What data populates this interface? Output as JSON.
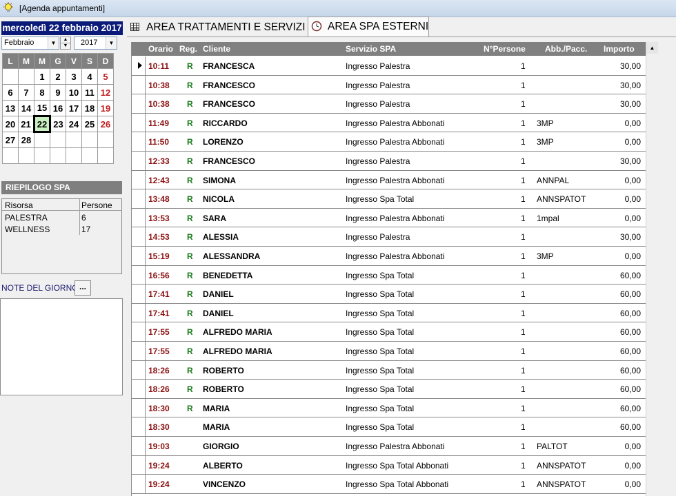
{
  "window": {
    "title": "[Agenda appuntamenti]"
  },
  "calendar": {
    "date_title": "mercoledì 22 febbraio 2017",
    "month_select": "Febbraio",
    "year_select": "2017",
    "weekday_headers": [
      "L",
      "M",
      "M",
      "G",
      "V",
      "S",
      "D"
    ],
    "weeks": [
      [
        "",
        "",
        "1",
        "2",
        "3",
        "4",
        "5"
      ],
      [
        "6",
        "7",
        "8",
        "9",
        "10",
        "11",
        "12"
      ],
      [
        "13",
        "14",
        "15",
        "16",
        "17",
        "18",
        "19"
      ],
      [
        "20",
        "21",
        "22",
        "23",
        "24",
        "25",
        "26"
      ],
      [
        "27",
        "28",
        "",
        "",
        "",
        "",
        ""
      ],
      [
        "",
        "",
        "",
        "",
        "",
        "",
        ""
      ]
    ],
    "today": "22"
  },
  "summary": {
    "title": "RIEPILOGO SPA",
    "col_resource": "Risorsa",
    "col_people": "Persone",
    "rows": [
      {
        "resource": "PALESTRA",
        "people": "6"
      },
      {
        "resource": "WELLNESS",
        "people": "17"
      }
    ]
  },
  "notes": {
    "label": "NOTE DEL GIORNO",
    "button": "..."
  },
  "tabs": [
    {
      "label": "AREA TRATTAMENTI E SERVIZI",
      "icon": "table-icon"
    },
    {
      "label": "AREA SPA ESTERNI",
      "icon": "clock-icon"
    }
  ],
  "grid": {
    "headers": {
      "time": "Orario",
      "reg": "Reg.",
      "client": "Cliente",
      "service": "Servizio SPA",
      "persons": "N°Persone",
      "abb": "Abb./Pacc.",
      "amount": "Importo"
    },
    "rows": [
      {
        "time": "10:11",
        "reg": "R",
        "client": "FRANCESCA",
        "service": "Ingresso Palestra",
        "persons": "1",
        "abb": "",
        "amount": "30,00"
      },
      {
        "time": "10:38",
        "reg": "R",
        "client": "FRANCESCO",
        "service": "Ingresso Palestra",
        "persons": "1",
        "abb": "",
        "amount": "30,00"
      },
      {
        "time": "10:38",
        "reg": "R",
        "client": "FRANCESCO",
        "service": "Ingresso Palestra",
        "persons": "1",
        "abb": "",
        "amount": "30,00"
      },
      {
        "time": "11:49",
        "reg": "R",
        "client": "RICCARDO",
        "service": "Ingresso Palestra Abbonati",
        "persons": "1",
        "abb": "3MP",
        "amount": "0,00"
      },
      {
        "time": "11:50",
        "reg": "R",
        "client": "LORENZO",
        "service": "Ingresso Palestra Abbonati",
        "persons": "1",
        "abb": "3MP",
        "amount": "0,00"
      },
      {
        "time": "12:33",
        "reg": "R",
        "client": "FRANCESCO",
        "service": "Ingresso Palestra",
        "persons": "1",
        "abb": "",
        "amount": "30,00"
      },
      {
        "time": "12:43",
        "reg": "R",
        "client": "SIMONA",
        "service": "Ingresso Palestra Abbonati",
        "persons": "1",
        "abb": "ANNPAL",
        "amount": "0,00"
      },
      {
        "time": "13:48",
        "reg": "R",
        "client": "NICOLA",
        "service": "Ingresso Spa Total",
        "persons": "1",
        "abb": "ANNSPATOT",
        "amount": "0,00"
      },
      {
        "time": "13:53",
        "reg": "R",
        "client": "SARA",
        "service": "Ingresso Palestra Abbonati",
        "persons": "1",
        "abb": "1mpal",
        "amount": "0,00"
      },
      {
        "time": "14:53",
        "reg": "R",
        "client": "ALESSIA",
        "service": "Ingresso Palestra",
        "persons": "1",
        "abb": "",
        "amount": "30,00"
      },
      {
        "time": "15:19",
        "reg": "R",
        "client": "ALESSANDRA",
        "service": "Ingresso Palestra Abbonati",
        "persons": "1",
        "abb": "3MP",
        "amount": "0,00"
      },
      {
        "time": "16:56",
        "reg": "R",
        "client": "BENEDETTA",
        "service": "Ingresso Spa Total",
        "persons": "1",
        "abb": "",
        "amount": "60,00"
      },
      {
        "time": "17:41",
        "reg": "R",
        "client": "DANIEL",
        "service": "Ingresso Spa Total",
        "persons": "1",
        "abb": "",
        "amount": "60,00"
      },
      {
        "time": "17:41",
        "reg": "R",
        "client": "DANIEL",
        "service": "Ingresso Spa Total",
        "persons": "1",
        "abb": "",
        "amount": "60,00"
      },
      {
        "time": "17:55",
        "reg": "R",
        "client": "ALFREDO MARIA",
        "service": "Ingresso Spa Total",
        "persons": "1",
        "abb": "",
        "amount": "60,00"
      },
      {
        "time": "17:55",
        "reg": "R",
        "client": "ALFREDO MARIA",
        "service": "Ingresso Spa Total",
        "persons": "1",
        "abb": "",
        "amount": "60,00"
      },
      {
        "time": "18:26",
        "reg": "R",
        "client": "ROBERTO",
        "service": "Ingresso Spa Total",
        "persons": "1",
        "abb": "",
        "amount": "60,00"
      },
      {
        "time": "18:26",
        "reg": "R",
        "client": "ROBERTO",
        "service": "Ingresso Spa Total",
        "persons": "1",
        "abb": "",
        "amount": "60,00"
      },
      {
        "time": "18:30",
        "reg": "R",
        "client": "MARIA",
        "service": "Ingresso Spa Total",
        "persons": "1",
        "abb": "",
        "amount": "60,00"
      },
      {
        "time": "18:30",
        "reg": "",
        "client": "MARIA",
        "service": "Ingresso Spa Total",
        "persons": "1",
        "abb": "",
        "amount": "60,00"
      },
      {
        "time": "19:03",
        "reg": "",
        "client": "GIORGIO",
        "service": "Ingresso Palestra Abbonati",
        "persons": "1",
        "abb": "PALTOT",
        "amount": "0,00"
      },
      {
        "time": "19:24",
        "reg": "",
        "client": "ALBERTO",
        "service": "Ingresso Spa Total Abbonati",
        "persons": "1",
        "abb": "ANNSPATOT",
        "amount": "0,00"
      },
      {
        "time": "19:24",
        "reg": "",
        "client": "VINCENZO",
        "service": "Ingresso Spa Total Abbonati",
        "persons": "1",
        "abb": "ANNSPATOT",
        "amount": "0,00"
      }
    ]
  }
}
